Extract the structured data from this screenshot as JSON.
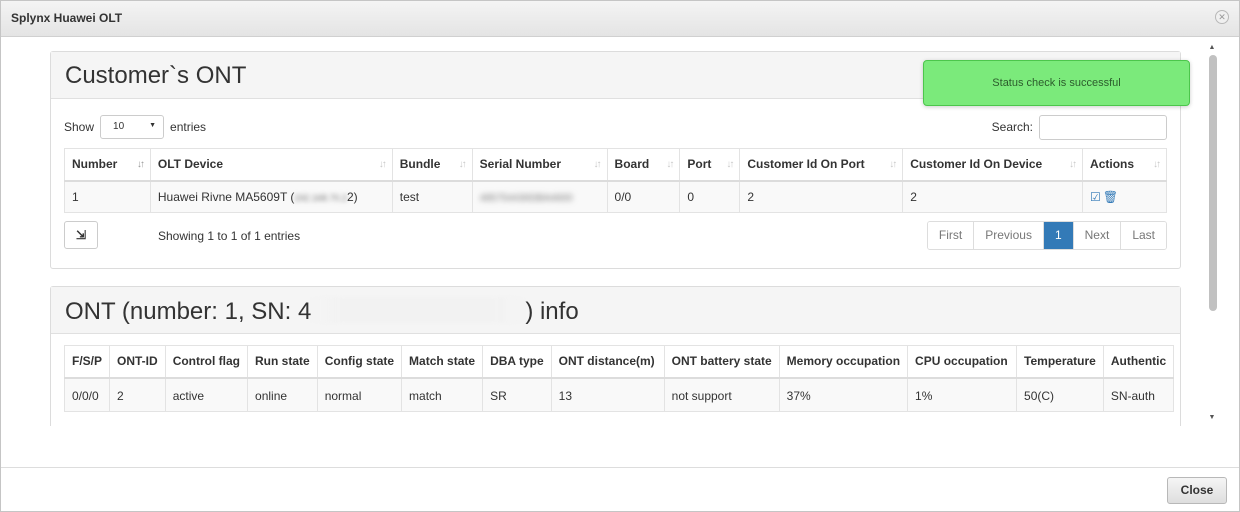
{
  "window": {
    "title": "Splynx Huawei OLT",
    "close_label": "Close"
  },
  "toast": {
    "message": "Status check is successful"
  },
  "customer_ont": {
    "title": "Customer`s ONT",
    "show_label": "Show",
    "entries_label": "entries",
    "page_size": "10",
    "search_label": "Search:",
    "columns": [
      "Number",
      "OLT Device",
      "Bundle",
      "Serial Number",
      "Board",
      "Port",
      "Customer Id On Port",
      "Customer Id On Device",
      "Actions"
    ],
    "rows": [
      {
        "number": "1",
        "olt_device": "Huawei Rivne MA5609T (",
        "olt_device_tail": "2)",
        "olt_device_hidden": "192.168.70.2",
        "bundle": "test",
        "serial_hidden": "485754430DBA4600",
        "board": "0/0",
        "port": "0",
        "cust_port": "2",
        "cust_device": "2"
      }
    ],
    "info": "Showing 1 to 1 of 1 entries",
    "pager": {
      "first": "First",
      "previous": "Previous",
      "current": "1",
      "next": "Next",
      "last": "Last"
    }
  },
  "ont_info": {
    "title_prefix": "ONT (number: 1, SN: 4",
    "title_suffix": ") info",
    "columns": [
      "F/S/P",
      "ONT-ID",
      "Control flag",
      "Run state",
      "Config state",
      "Match state",
      "DBA type",
      "ONT distance(m)",
      "ONT battery state",
      "Memory occupation",
      "CPU occupation",
      "Temperature",
      "Authentic"
    ],
    "row": [
      "0/0/0",
      "2",
      "active",
      "online",
      "normal",
      "match",
      "SR",
      "13",
      "not support",
      "37%",
      "1%",
      "50(C)",
      "SN-auth"
    ]
  },
  "icons": {
    "close": "circle-x-icon",
    "export": "export-icon",
    "edit": "edit-check-icon",
    "delete": "trash-icon"
  }
}
